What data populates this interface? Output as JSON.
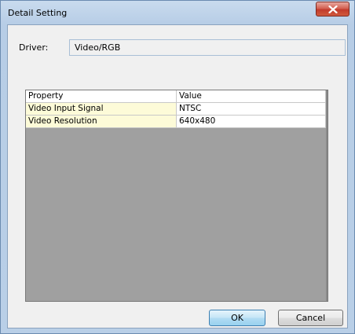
{
  "window": {
    "title": "Detail Setting",
    "close_icon": "close-icon"
  },
  "driver": {
    "label": "Driver:",
    "value": "Video/RGB"
  },
  "grid": {
    "columns": [
      "Property",
      "Value"
    ],
    "rows": [
      [
        "Video Input Signal",
        "NTSC"
      ],
      [
        "Video Resolution",
        "640x480"
      ]
    ]
  },
  "buttons": {
    "ok": "OK",
    "cancel": "Cancel"
  },
  "colors": {
    "property_cell_bg": "#fdfbd8",
    "grid_empty_bg": "#a0a0a0",
    "close_button": "#c23b2c"
  }
}
